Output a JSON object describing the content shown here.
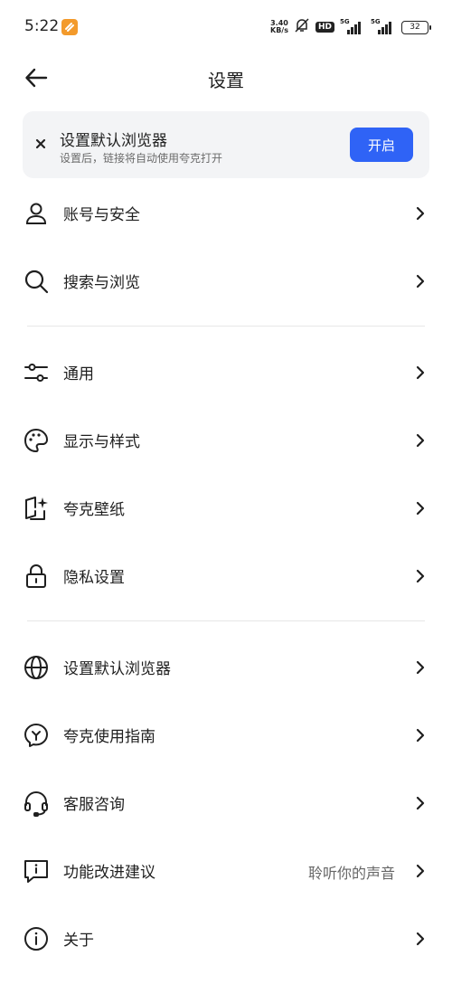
{
  "status_bar": {
    "time": "5:22",
    "net_speed_value": "3.40",
    "net_speed_unit": "KB/s",
    "hd_label": "HD",
    "signal_label_1": "5G",
    "signal_label_2": "5G",
    "battery": "32"
  },
  "header": {
    "title": "设置"
  },
  "banner": {
    "title": "设置默认浏览器",
    "subtitle": "设置后，链接将自动使用夸克打开",
    "button_label": "开启",
    "accent_color": "#2f63f6"
  },
  "sections": [
    {
      "items": [
        {
          "label": "账号与安全",
          "icon": "person-icon"
        },
        {
          "label": "搜索与浏览",
          "icon": "search-icon"
        }
      ]
    },
    {
      "items": [
        {
          "label": "通用",
          "icon": "sliders-icon"
        },
        {
          "label": "显示与样式",
          "icon": "palette-icon"
        },
        {
          "label": "夸克壁纸",
          "icon": "wallpaper-icon"
        },
        {
          "label": "隐私设置",
          "icon": "lock-icon"
        }
      ]
    },
    {
      "items": [
        {
          "label": "设置默认浏览器",
          "icon": "globe-icon"
        },
        {
          "label": "夸克使用指南",
          "icon": "guide-icon"
        },
        {
          "label": "客服咨询",
          "icon": "headset-icon"
        },
        {
          "label": "功能改进建议",
          "icon": "feedback-icon",
          "value": "聆听你的声音"
        },
        {
          "label": "关于",
          "icon": "info-icon"
        }
      ]
    }
  ]
}
